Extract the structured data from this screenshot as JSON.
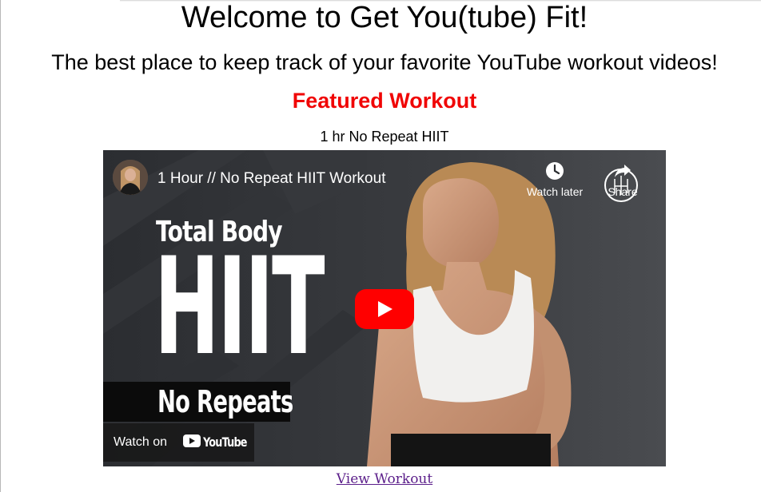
{
  "page": {
    "title": "Welcome to Get You(tube) Fit!",
    "tagline": "The best place to keep track of your favorite YouTube workout videos!",
    "featured_heading": "Featured Workout",
    "accent_color": "#f00505"
  },
  "featured": {
    "workout_name": "1 hr No Repeat HIIT",
    "link_label": "View Workout",
    "link_color": "#5b1e8a"
  },
  "player": {
    "video_title": "1 Hour // No Repeat HIIT Workout",
    "watch_later_label": "Watch later",
    "share_label": "Share",
    "watch_on_label": "Watch on",
    "youtube_wordmark": "YouTube",
    "play_button_color": "#ff0000",
    "thumbnail_text": {
      "line1": "Total Body",
      "line2": "HIIT",
      "line3": "No Repeats"
    },
    "icons": {
      "watch_later": "clock-icon",
      "share": "share-arrow-icon",
      "play": "play-icon",
      "youtube": "youtube-logo-icon"
    }
  }
}
